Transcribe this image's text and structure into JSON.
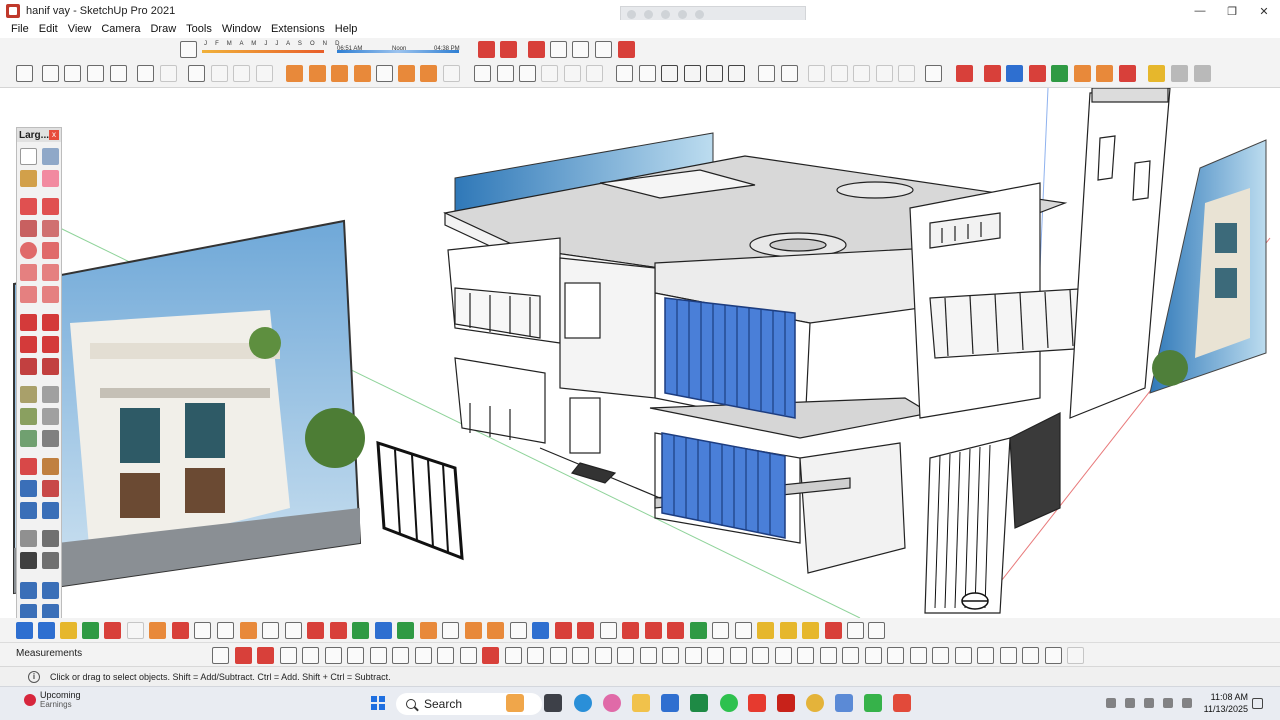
{
  "window": {
    "title": "hanif vay - SketchUp Pro 2021",
    "minimize": "—",
    "maximize": "❐",
    "close": "✕"
  },
  "menu": [
    "File",
    "Edit",
    "View",
    "Camera",
    "Draw",
    "Tools",
    "Window",
    "Extensions",
    "Help"
  ],
  "shadow": {
    "months": "J F M A M J J A S O N D",
    "time_start": "06:51 AM",
    "time_mid": "Noon",
    "time_end": "04:38 PM"
  },
  "tray": {
    "title": "Larg...",
    "close": "x"
  },
  "measurements_label": "Measurements",
  "status_text": "Click or drag to select objects. Shift = Add/Subtract. Ctrl = Add. Shift + Ctrl = Subtract.",
  "taskbar": {
    "weather_title": "Upcoming",
    "weather_sub": "Earnings",
    "search_label": "Search",
    "clock_time": "11:08 AM",
    "clock_date": "11/13/2025"
  },
  "colors": {
    "accent_red": "#d8403a",
    "accent_blue": "#2e6fd0",
    "accent_green": "#2f9a44",
    "facade_blue": "#4a7fd8"
  }
}
